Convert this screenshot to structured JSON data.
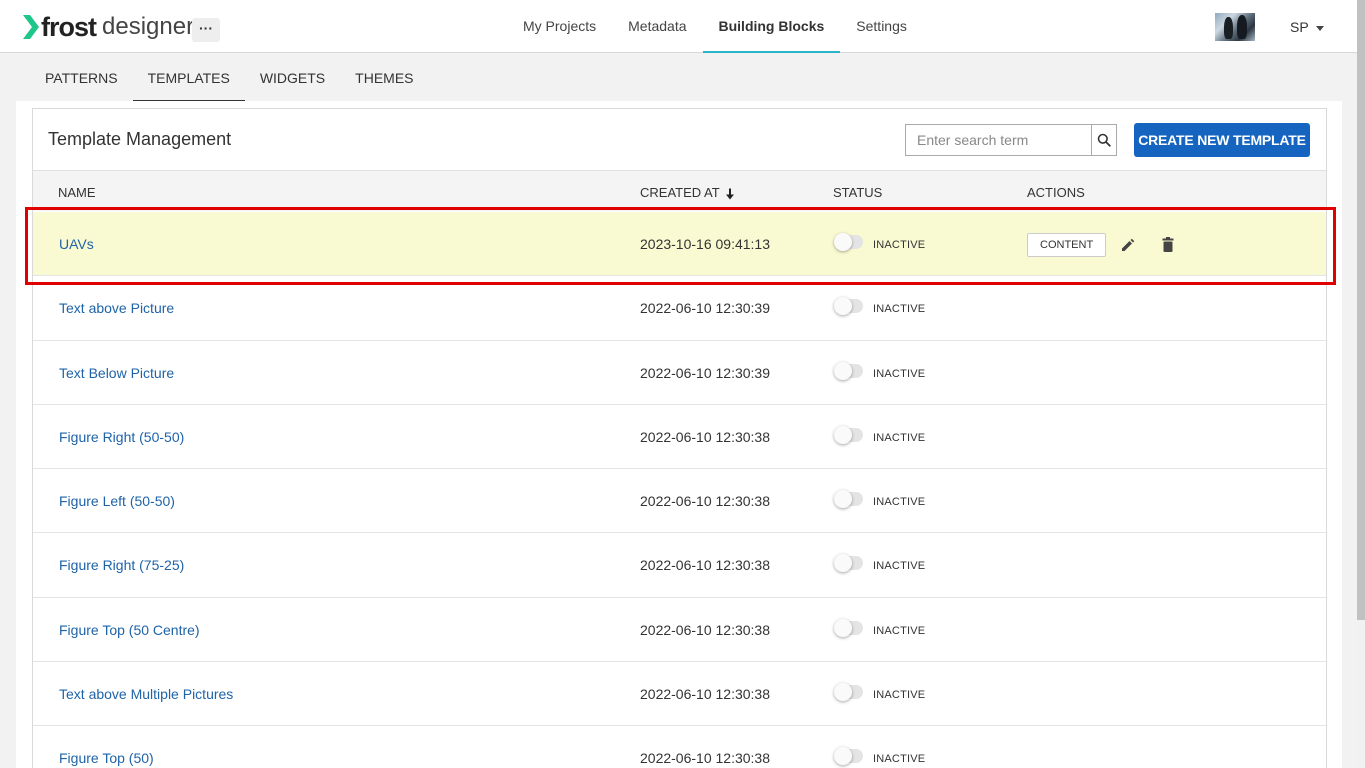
{
  "header": {
    "logo_brand": "frost",
    "logo_product": "designer",
    "more_label": "···",
    "nav": [
      {
        "label": "My Projects"
      },
      {
        "label": "Metadata"
      },
      {
        "label": "Building Blocks"
      },
      {
        "label": "Settings"
      }
    ],
    "active_nav": "Building Blocks",
    "user_initials": "SP",
    "accent_color": "#2bb5c9"
  },
  "subnav": {
    "items": [
      {
        "label": "PATTERNS"
      },
      {
        "label": "TEMPLATES"
      },
      {
        "label": "WIDGETS"
      },
      {
        "label": "THEMES"
      }
    ],
    "active": "TEMPLATES"
  },
  "panel": {
    "title": "Template Management",
    "search_placeholder": "Enter search term",
    "create_label": "CREATE NEW TEMPLATE",
    "primary_color": "#1565c0"
  },
  "table": {
    "columns": {
      "name": "NAME",
      "created": "CREATED AT",
      "status": "STATUS",
      "actions": "ACTIONS"
    },
    "sort_column": "created",
    "sort_direction": "descending",
    "content_label": "CONTENT",
    "rows": [
      {
        "name": "UAVs",
        "created": "2023-10-16 09:41:13",
        "status": "INACTIVE"
      },
      {
        "name": "Text above Picture",
        "created": "2022-06-10 12:30:39",
        "status": "INACTIVE"
      },
      {
        "name": "Text Below Picture",
        "created": "2022-06-10 12:30:39",
        "status": "INACTIVE"
      },
      {
        "name": "Figure Right (50-50)",
        "created": "2022-06-10 12:30:38",
        "status": "INACTIVE"
      },
      {
        "name": "Figure Left (50-50)",
        "created": "2022-06-10 12:30:38",
        "status": "INACTIVE"
      },
      {
        "name": "Figure Right (75-25)",
        "created": "2022-06-10 12:30:38",
        "status": "INACTIVE"
      },
      {
        "name": "Figure Top (50 Centre)",
        "created": "2022-06-10 12:30:38",
        "status": "INACTIVE"
      },
      {
        "name": "Text above Multiple Pictures",
        "created": "2022-06-10 12:30:38",
        "status": "INACTIVE"
      },
      {
        "name": "Figure Top (50)",
        "created": "2022-06-10 12:30:38",
        "status": "INACTIVE"
      }
    ],
    "highlighted_row": 0,
    "highlight_color": "#fafad2",
    "frame_color": "#e00000"
  }
}
